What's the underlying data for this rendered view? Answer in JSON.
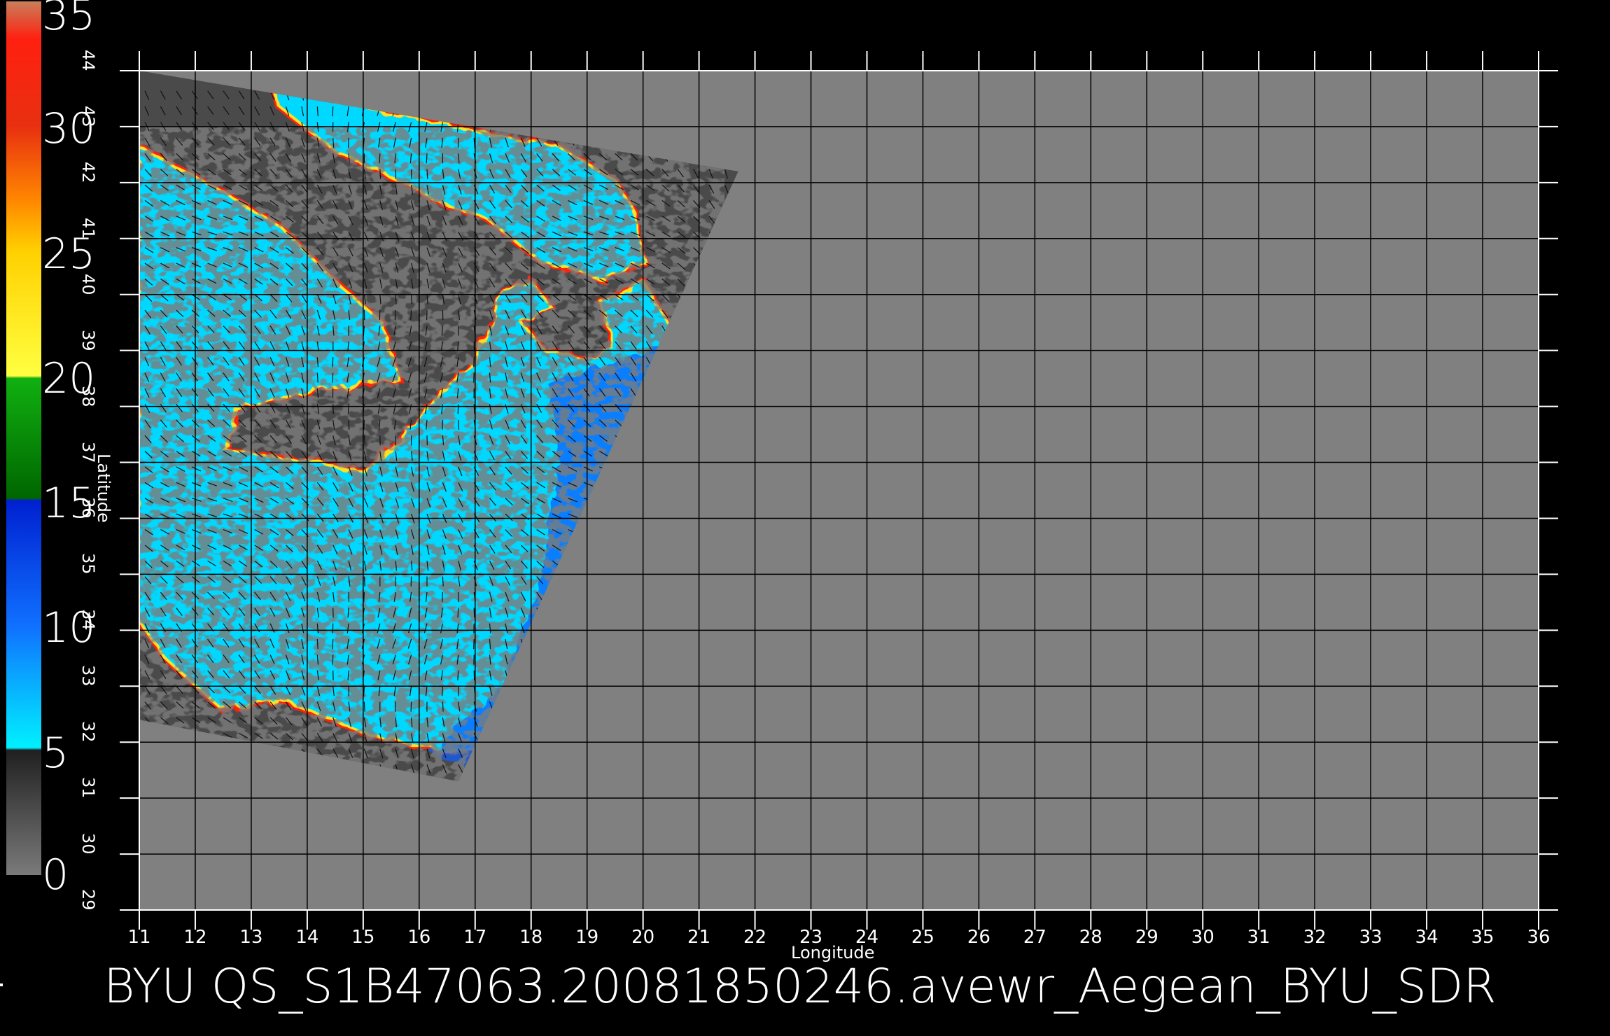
{
  "chart_data": {
    "type": "heatmap",
    "title": "",
    "xlabel": "Longitude",
    "ylabel": "Latitude",
    "xlim": [
      11,
      36
    ],
    "ylim": [
      29,
      44
    ],
    "xticks": [
      "11",
      "12",
      "13",
      "14",
      "15",
      "16",
      "17",
      "18",
      "19",
      "20",
      "21",
      "22",
      "23",
      "24",
      "25",
      "26",
      "27",
      "28",
      "29",
      "30",
      "31",
      "32",
      "33",
      "34",
      "35",
      "36"
    ],
    "yticks": [
      "29",
      "30",
      "31",
      "32",
      "33",
      "34",
      "35",
      "36",
      "37",
      "38",
      "39",
      "40",
      "41",
      "42",
      "43",
      "44"
    ],
    "grid": true,
    "colorbar": {
      "labels": [
        "35",
        "30",
        "25",
        "20",
        "15",
        "10",
        "5",
        "0"
      ],
      "min": 0,
      "max": 35,
      "stops": [
        {
          "value": 35,
          "color": "#c87f5a"
        },
        {
          "value": 33.5,
          "color": "#ff2010"
        },
        {
          "value": 30,
          "color": "#e83010"
        },
        {
          "value": 27,
          "color": "#ff8800"
        },
        {
          "value": 25,
          "color": "#ffd000"
        },
        {
          "value": 20,
          "color": "#ffff40"
        },
        {
          "value": 19.9,
          "color": "#10b010"
        },
        {
          "value": 15.1,
          "color": "#006600"
        },
        {
          "value": 15,
          "color": "#0020d0"
        },
        {
          "value": 10,
          "color": "#1070ff"
        },
        {
          "value": 5.1,
          "color": "#00f0ff"
        },
        {
          "value": 5,
          "color": "#202020"
        },
        {
          "value": 0,
          "color": "#7a7a7a"
        }
      ]
    },
    "swath_outline": [
      [
        11.0,
        44.0
      ],
      [
        21.7,
        42.2
      ],
      [
        16.7,
        31.3
      ],
      [
        11.0,
        32.4
      ]
    ],
    "colors": {
      "background": "#000000",
      "no_data": "#808080",
      "land": "#4a4a4a",
      "wind_low": "#00d8ff",
      "wind_mid": "#1060ff",
      "wind_high": "#0020c0",
      "coast_edge": "#ff2010"
    }
  },
  "footer": {
    "filename": "BYU  QS_S1B47063.20081850246.avewr_Aegean_BYU_SDR"
  }
}
